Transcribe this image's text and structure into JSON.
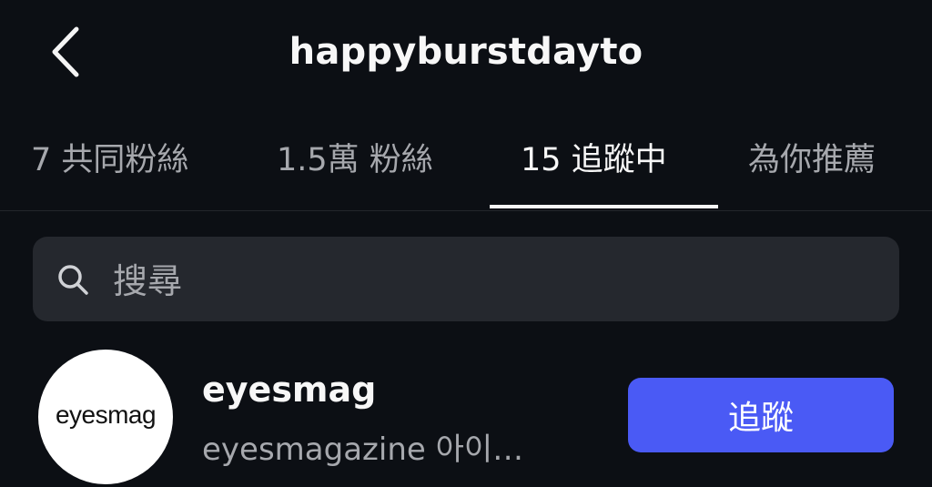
{
  "header": {
    "back_icon": "chevron-left-icon",
    "title": "happyburstdayto"
  },
  "tabs": [
    {
      "label": "7 共同粉絲",
      "active": false
    },
    {
      "label": "1.5萬 粉絲",
      "active": false
    },
    {
      "label": "15 追蹤中",
      "active": true
    },
    {
      "label": "為你推薦",
      "active": false
    }
  ],
  "search": {
    "icon": "search-icon",
    "placeholder": "搜尋"
  },
  "list": [
    {
      "avatar_text": "eyesmag",
      "username": "eyesmag",
      "full_name": "eyesmagazine 아이…",
      "button_label": "追蹤"
    }
  ],
  "colors": {
    "background": "#0c0f14",
    "search_background": "#25282e",
    "follow_button": "#4a5af5",
    "muted_text": "#a6a8ad"
  }
}
